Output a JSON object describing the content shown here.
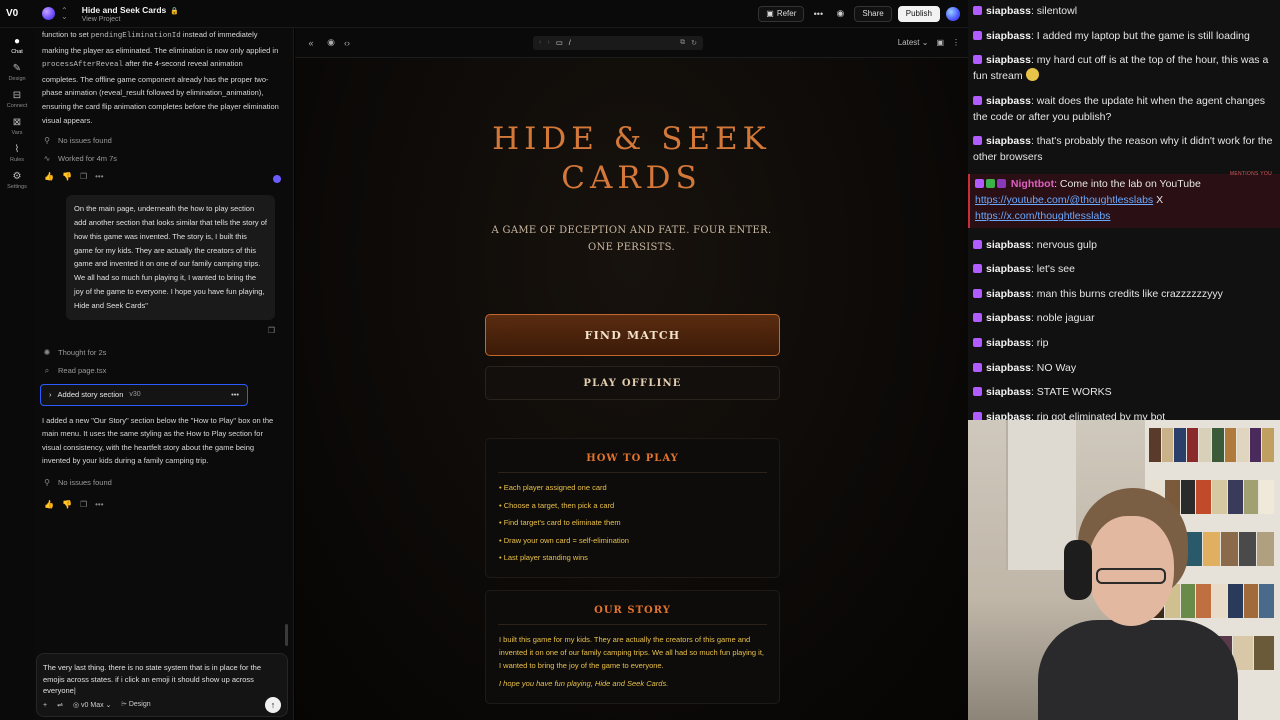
{
  "topbar": {
    "logo": "V0",
    "project_name": "Hide and Seek Cards",
    "project_sub": "View Project",
    "refer": "Refer",
    "share": "Share",
    "publish": "Publish"
  },
  "rail": [
    {
      "label": "Chat",
      "icon": "chat-icon"
    },
    {
      "label": "Design",
      "icon": "design-icon"
    },
    {
      "label": "Connect",
      "icon": "connect-icon"
    },
    {
      "label": "Vars",
      "icon": "vars-icon"
    },
    {
      "label": "Rules",
      "icon": "rules-icon"
    },
    {
      "label": "Settings",
      "icon": "settings-icon"
    }
  ],
  "chat": {
    "msg1_pre": "function to set ",
    "msg1_code1": "pendingEliminationId",
    "msg1_mid": " instead of immediately marking the player as eliminated. The elimination is now only applied in ",
    "msg1_code2": "processAfterReveal",
    "msg1_post": " after the 4-second reveal animation completes. The offline game component already has the proper two-phase animation (reveal_result followed by elimination_animation), ensuring the card flip animation completes before the player elimination visual appears.",
    "no_issues_1": "No issues found",
    "worked_for": "Worked for 4m 7s",
    "user_msg": "On the main page, underneath the how to play section add another section that looks similar that tells the story of how this game was invented. The story is, I built this game for my kids. They are actually the creators of this game and invented it on one of our family camping trips. We all had so much fun playing it, I wanted to bring the joy of the game to everyone. I hope you have fun playing, Hide and Seek Cards\"",
    "thought": "Thought for 2s",
    "read_file": "Read page.tsx",
    "version_label": "Added story section",
    "version_num": "v30",
    "msg2": "I added a new \"Our Story\" section below the \"How to Play\" box on the main menu. It uses the same styling as the How to Play section for visual consistency, with the heartfelt story about the game being invented by your kids during a family camping trip.",
    "no_issues_2": "No issues found",
    "prompt_text": "The very last thing. there is no state system that is in place for the emojis across states. if i click an emoji it should show up across everyone|",
    "model": "v0 Max",
    "design": "Design"
  },
  "preview": {
    "url": "/",
    "version": "Latest",
    "title_line1": "HIDE & SEEK",
    "title_line2": "CARDS",
    "subtitle": "A GAME OF DECEPTION AND FATE. FOUR ENTER. ONE PERSISTS.",
    "find_match": "FIND MATCH",
    "play_offline": "PLAY OFFLINE",
    "how_to_play": {
      "heading": "HOW TO PLAY",
      "items": [
        "• Each player assigned one card",
        "• Choose a target, then pick a card",
        "• Find target's card to eliminate them",
        "• Draw your own card = self-elimination",
        "• Last player standing wins"
      ]
    },
    "story": {
      "heading": "OUR STORY",
      "text": "I built this game for my kids. They are actually the creators of this game and invented it on one of our family camping trips. We all had so much fun playing it, I wanted to bring the joy of the game to everyone.",
      "sign": "I hope you have fun playing, Hide and Seek Cards."
    }
  },
  "stream_chat": {
    "messages": [
      {
        "user": "siapbass",
        "text": "silentowl"
      },
      {
        "user": "siapbass",
        "text": "I added my laptop but the game is still loading"
      },
      {
        "user": "siapbass",
        "text": "my hard cut off is at the top of the hour, this was a fun stream"
      },
      {
        "user": "siapbass",
        "text": "wait does the update hit when the agent changes the code or after you publish?"
      },
      {
        "user": "siapbass",
        "text": "that's probably the reason why it didn't work for the other browsers"
      },
      {
        "user": "siapbass",
        "text": "nervous gulp"
      },
      {
        "user": "siapbass",
        "text": "let's see"
      },
      {
        "user": "siapbass",
        "text": "man this burns credits like crazzzzzzyyy"
      },
      {
        "user": "siapbass",
        "text": "noble jaguar"
      },
      {
        "user": "siapbass",
        "text": "rip"
      },
      {
        "user": "siapbass",
        "text": "NO Way"
      },
      {
        "user": "siapbass",
        "text": "STATE WORKS"
      },
      {
        "user": "siapbass",
        "text": "rip got eliminated by my bot"
      }
    ],
    "bot": {
      "user": "Nightbot",
      "text": ": Come into the lab on YouTube ",
      "link1": "https://youtube.com/@thoughtlesslabs",
      "sep": " X ",
      "link2": "https://x.com/thoughtlesslabs",
      "mention": "MENTIONS YOU"
    },
    "colors": {
      "badge": "#b05cff",
      "bot_bg": "#2a0f14",
      "link": "#6aa9ff"
    }
  },
  "colors": {
    "accent_orange": "#d4783a",
    "gold_text": "#e8c04a",
    "select_blue": "#2c5cff"
  }
}
